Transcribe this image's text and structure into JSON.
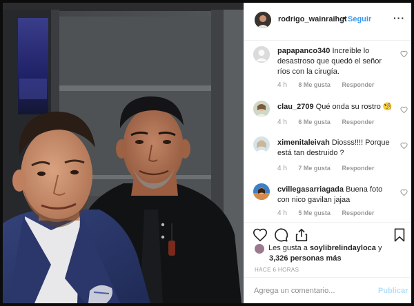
{
  "post": {
    "author": "rodrigo_wainraihgt",
    "dot": "•",
    "follow_label": "Seguir",
    "more_label": "···"
  },
  "comments": [
    {
      "user": "papapanco340",
      "text": "Increíble lo desastroso que quedó el señor ríos con la cirugía.",
      "time": "4 h",
      "likes": "8 Me gusta",
      "reply": "Responder"
    },
    {
      "user": "clau_2709",
      "text": "Qué onda su rostro",
      "emoji": "🧐",
      "time": "4 h",
      "likes": "6 Me gusta",
      "reply": "Responder"
    },
    {
      "user": "ximenitaleivah",
      "text": "Diosss!!!! Porque está tan destruido ?",
      "time": "4 h",
      "likes": "7 Me gusta",
      "reply": "Responder"
    },
    {
      "user": "cvillegasarriagada",
      "text": "Buena foto con nico gavilan jajaa",
      "time": "4 h",
      "likes": "5 Me gusta",
      "reply": "Responder"
    }
  ],
  "likes": {
    "prefix": "Les gusta a",
    "user": "soylibrelindayloca",
    "conj": "y",
    "others": "3,326 personas más"
  },
  "time_ago": "HACE 6 HORAS",
  "add_comment": {
    "placeholder": "Agrega un comentario...",
    "publish_label": "Publicar"
  },
  "icons": {
    "like": "heart-icon",
    "comment": "comment-bubble-icon",
    "share": "share-icon",
    "save": "bookmark-icon"
  },
  "colors": {
    "link_blue": "#3897f0",
    "publish_disabled": "#b2dffc",
    "meta_gray": "#999999"
  }
}
